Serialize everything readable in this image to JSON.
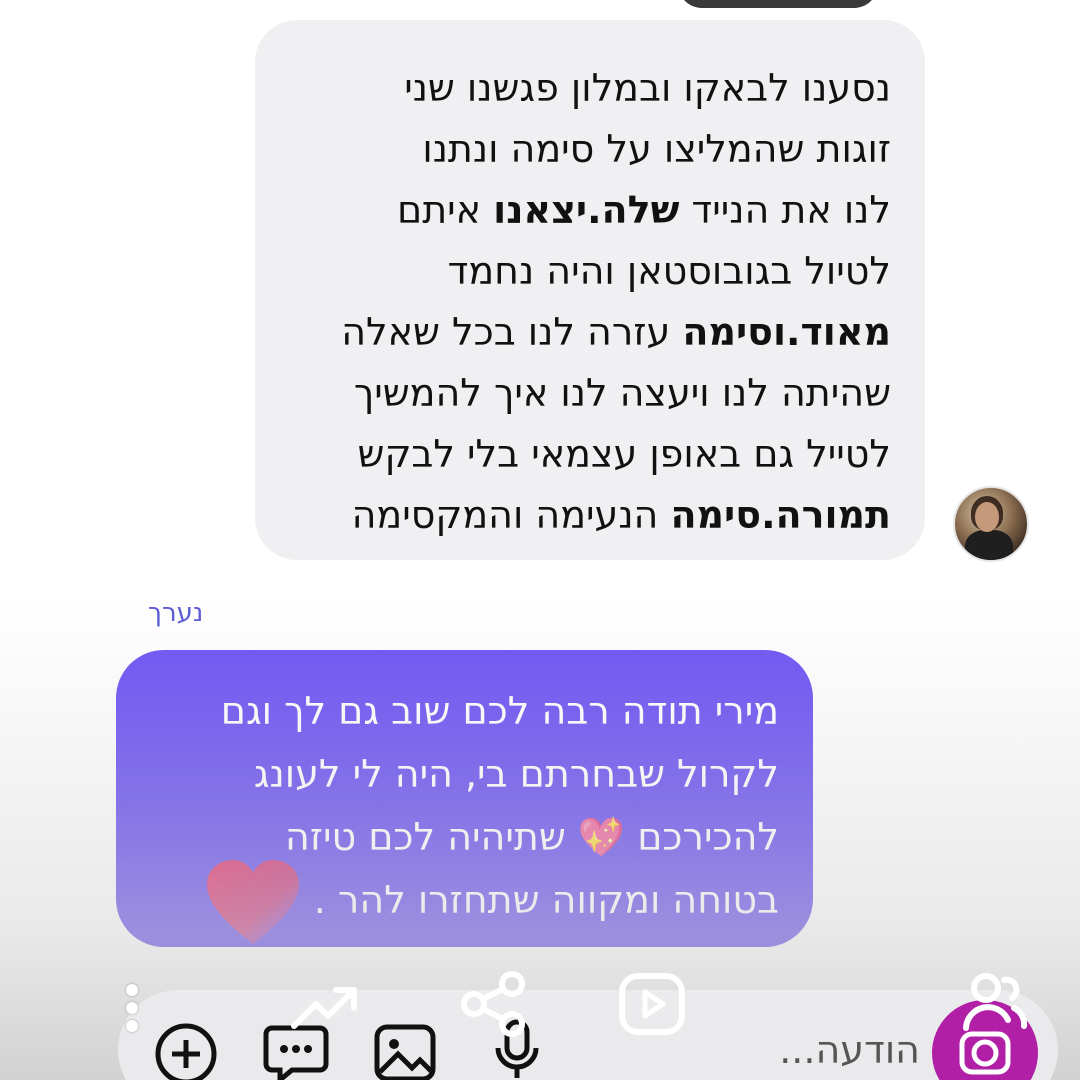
{
  "incoming_message": {
    "lines": [
      {
        "plain_a": "נסענו לבאקו ובמלון פגשנו שני",
        "bold": "",
        "plain_b": ""
      },
      {
        "plain_a": "זוגות שהמליצו על סימה ונתנו",
        "bold": "",
        "plain_b": ""
      },
      {
        "plain_a": "לנו את הנייד ",
        "bold": "שלה.יצאנו",
        "plain_b": " איתם"
      },
      {
        "plain_a": "לטיול בגובוסטאן והיה נחמד",
        "bold": "",
        "plain_b": ""
      },
      {
        "plain_a": "",
        "bold": "מאוד.וסימה",
        "plain_b": " עזרה לנו בכל שאלה"
      },
      {
        "plain_a": "שהיתה לנו ויעצה לנו איך להמשיך",
        "bold": "",
        "plain_b": ""
      },
      {
        "plain_a": "לטייל גם באופן עצמאי בלי לבקש",
        "bold": "",
        "plain_b": ""
      },
      {
        "plain_a": "",
        "bold": "תמורה.סימה",
        "plain_b": " הנעימה והמקסימה"
      }
    ]
  },
  "edited_label": "נערך",
  "outgoing_message": {
    "lines": [
      "מירי תודה רבה לכם שוב גם לך וגם",
      "לקרול שבחרתם בי, היה לי לעונג",
      "להכירכם 💖 שתיהיה לכם טיזה",
      "בטוחה ומקווה שתחזרו להר ."
    ]
  },
  "composer": {
    "placeholder": "הודעה..."
  },
  "icons": {
    "overlay_row": [
      "more-vertical-icon",
      "trending-up-icon",
      "share-icon",
      "video-play-icon",
      "add-person-icon"
    ],
    "composer_row": [
      "add-icon",
      "sticker-icon",
      "gallery-icon",
      "microphone-icon",
      "camera-icon"
    ]
  },
  "colors": {
    "outgoing_bubble": "#5e44f1",
    "incoming_bubble": "#f0f0f2",
    "camera_button": "#b01fa6",
    "edited_label": "#5a5ad6"
  }
}
